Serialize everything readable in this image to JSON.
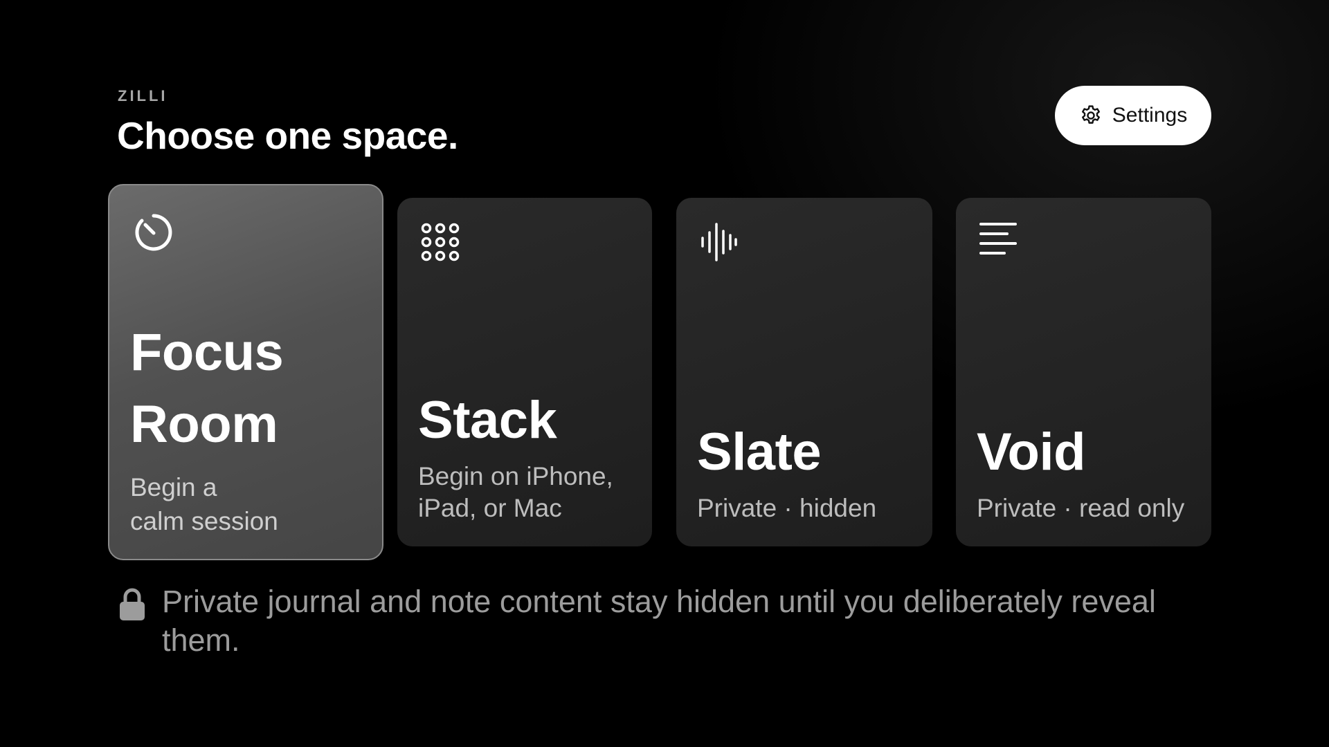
{
  "brand": "ZILLI",
  "heading": "Choose one space.",
  "settings": {
    "label": "Settings",
    "icon": "gear-icon"
  },
  "cards": [
    {
      "title_line1": "Focus",
      "title_line2": "Room",
      "subtitle_line1": "Begin a",
      "subtitle_line2": "calm session",
      "icon": "timer-icon",
      "selected": true
    },
    {
      "title": "Stack",
      "subtitle_line1": "Begin on iPhone,",
      "subtitle_line2": "iPad, or Mac",
      "icon": "grid-dots-icon",
      "selected": false
    },
    {
      "title": "Slate",
      "subtitle": "Private · hidden",
      "icon": "waveform-icon",
      "selected": false
    },
    {
      "title": "Void",
      "subtitle": "Private · read only",
      "icon": "text-lines-icon",
      "selected": false
    }
  ],
  "footer": {
    "icon": "lock-icon",
    "text": "Private journal and note content stay hidden until you deliberately reveal them."
  },
  "colors": {
    "background": "#000000",
    "card": "#222222",
    "card_selected": "#5a5a5a",
    "text_primary": "#ffffff",
    "text_secondary": "#bdbdbd",
    "button_bg": "#ffffff"
  }
}
